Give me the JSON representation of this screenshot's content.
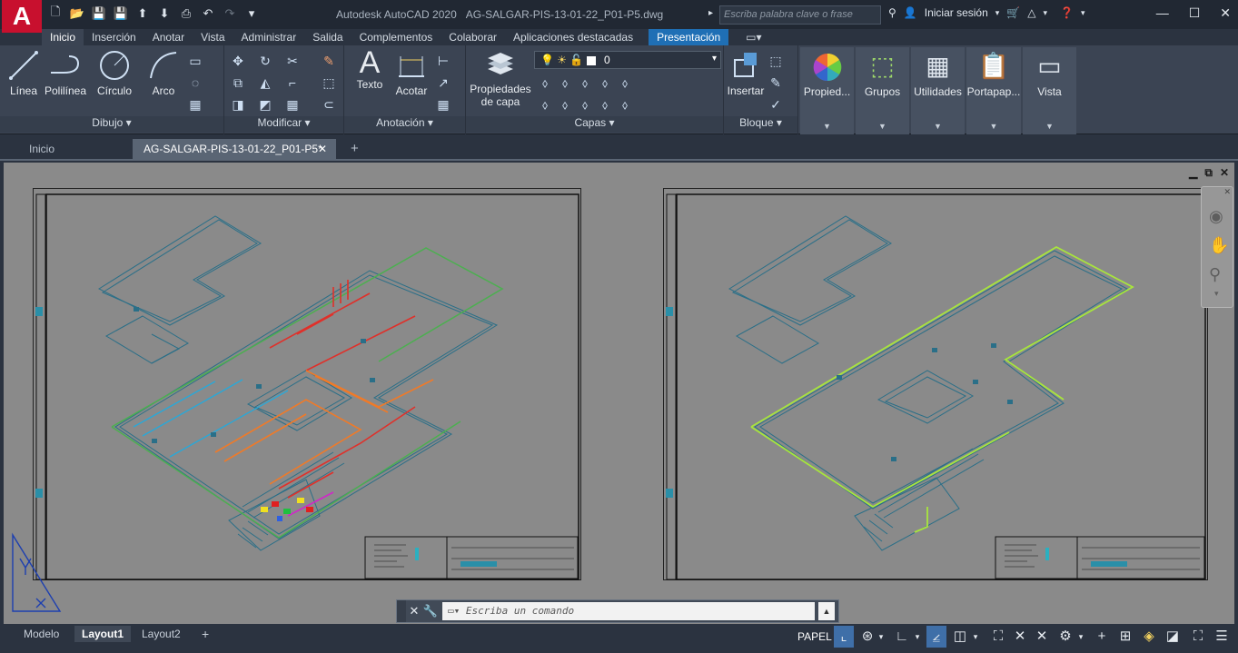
{
  "app": {
    "logo": "A",
    "title": "Autodesk AutoCAD 2020",
    "filename": "AG-SALGAR-PIS-13-01-22_P01-P5.dwg"
  },
  "search": {
    "placeholder": "Escriba palabra clave o frase"
  },
  "account": {
    "signin": "Iniciar sesión"
  },
  "ribbon_tabs": [
    "Inicio",
    "Inserción",
    "Anotar",
    "Vista",
    "Administrar",
    "Salida",
    "Complementos",
    "Colaborar",
    "Aplicaciones destacadas",
    "Presentación"
  ],
  "ribbon": {
    "dibujo": {
      "title": "Dibujo",
      "linea": "Línea",
      "polilinea": "Polilínea",
      "circulo": "Círculo",
      "arco": "Arco"
    },
    "modificar": {
      "title": "Modificar"
    },
    "anotacion": {
      "title": "Anotación",
      "texto": "Texto",
      "acotar": "Acotar"
    },
    "capas": {
      "title": "Capas",
      "propiedades": "Propiedades de capa",
      "layer_value": "0"
    },
    "bloque": {
      "title": "Bloque",
      "insertar": "Insertar"
    },
    "propiedades": "Propied...",
    "grupos": "Grupos",
    "utilidades": "Utilidades",
    "portapapeles": "Portapap...",
    "vista": "Vista"
  },
  "doc_tabs": {
    "home": "Inicio",
    "active": "AG-SALGAR-PIS-13-01-22_P01-P5*",
    "add": "+"
  },
  "command": {
    "placeholder": "Escriba un comando"
  },
  "layout_tabs": {
    "modelo": "Modelo",
    "layout1": "Layout1",
    "layout2": "Layout2",
    "add": "+"
  },
  "status": {
    "space": "PAPEL"
  },
  "colors": {
    "accent": "#1f6fb5",
    "brand": "#c8102e",
    "pipe_green": "#a8e63c",
    "pipe_red": "#e0302a",
    "pipe_orange": "#f07a28",
    "iso_blue": "#2a6f88"
  }
}
